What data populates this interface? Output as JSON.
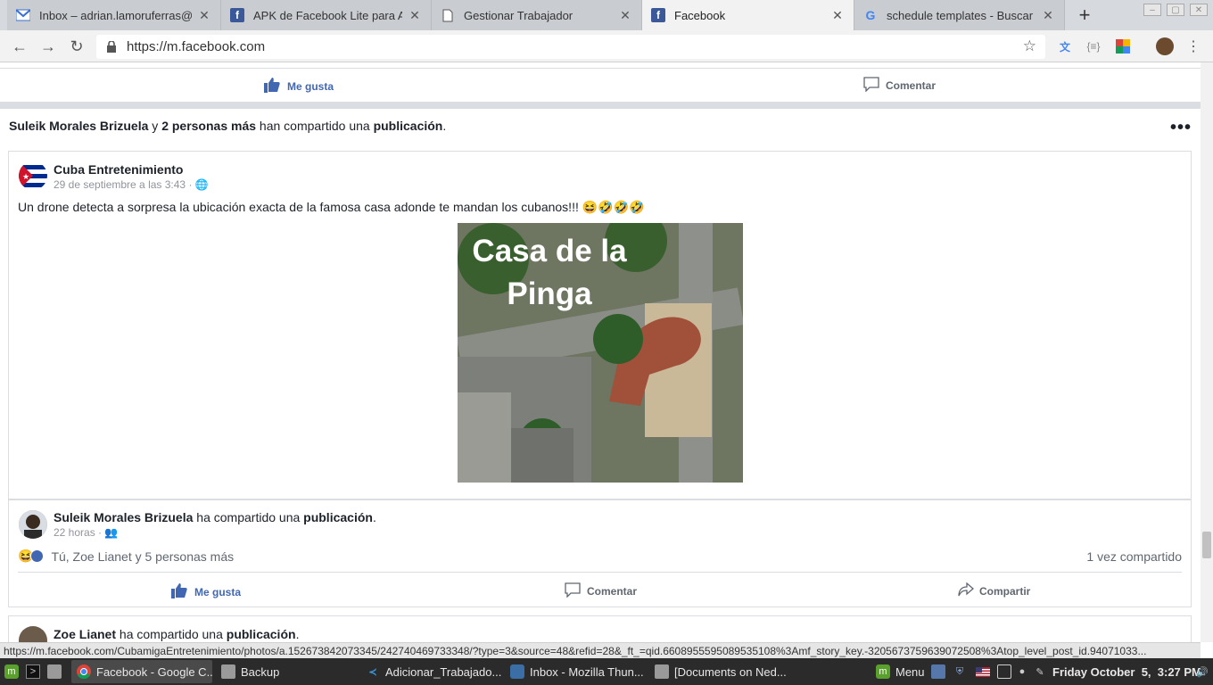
{
  "browser": {
    "tabs": [
      {
        "title": "Inbox – adrian.lamoruferras@g",
        "icon": "gmail-icon",
        "active": false
      },
      {
        "title": "APK de Facebook Lite para And",
        "icon": "facebook-icon",
        "active": false
      },
      {
        "title": "Gestionar Trabajador",
        "icon": "document-icon",
        "active": false
      },
      {
        "title": "Facebook",
        "icon": "facebook-icon",
        "active": true
      },
      {
        "title": "schedule templates - Buscar co",
        "icon": "google-icon",
        "active": false
      }
    ],
    "url": "https://m.facebook.com",
    "status_url": "https://m.facebook.com/CubamigaEntretenimiento/photos/a.152673842073345/242740469733348/?type=3&source=48&refid=28&_ft_=qid.6608955595089535108%3Amf_story_key.-3205673759639072508%3Atop_level_post_id.94071033..."
  },
  "top_actions": {
    "like": "Me gusta",
    "comment": "Comentar"
  },
  "story": {
    "header": {
      "actor": "Suleik Morales Brizuela",
      "connector": " y ",
      "others": "2 personas más",
      "action": " han compartido una ",
      "object": "publicación",
      "end": "."
    },
    "original_post": {
      "page_name": "Cuba Entretenimiento",
      "timestamp": "29 de septiembre a las 3:43",
      "text": "Un drone detecta a sorpresa la ubicación exacta de la famosa casa adonde te mandan los cubanos!!! 😆🤣🤣🤣",
      "image_caption_line1": "Casa de la",
      "image_caption_line2": "Pinga"
    },
    "share": {
      "name": "Suleik Morales Brizuela",
      "action": " ha compartido una ",
      "object": "publicación",
      "end": ".",
      "time": "22 horas",
      "reactions_text": "Tú, Zoe Lianet y 5 personas más",
      "share_count": "1 vez compartido",
      "like": "Me gusta",
      "comment": "Comentar",
      "share_label": "Compartir"
    }
  },
  "next_story": {
    "name": "Zoe Lianet",
    "action": " ha compartido una ",
    "object": "publicación",
    "end": "."
  },
  "taskbar": {
    "items": [
      {
        "label": "Facebook - Google C...",
        "active": true
      },
      {
        "label": "Backup",
        "active": false
      },
      {
        "label": "Adicionar_Trabajado...",
        "active": false
      },
      {
        "label": "Inbox - Mozilla Thun...",
        "active": false
      },
      {
        "label": "[Documents on Ned...",
        "active": false
      }
    ],
    "menu_label": "Menu",
    "clock": "Friday October  5,  3:27 PM"
  },
  "colors": {
    "facebook_blue": "#4267b2",
    "taskbar": "#2b2b2b"
  }
}
